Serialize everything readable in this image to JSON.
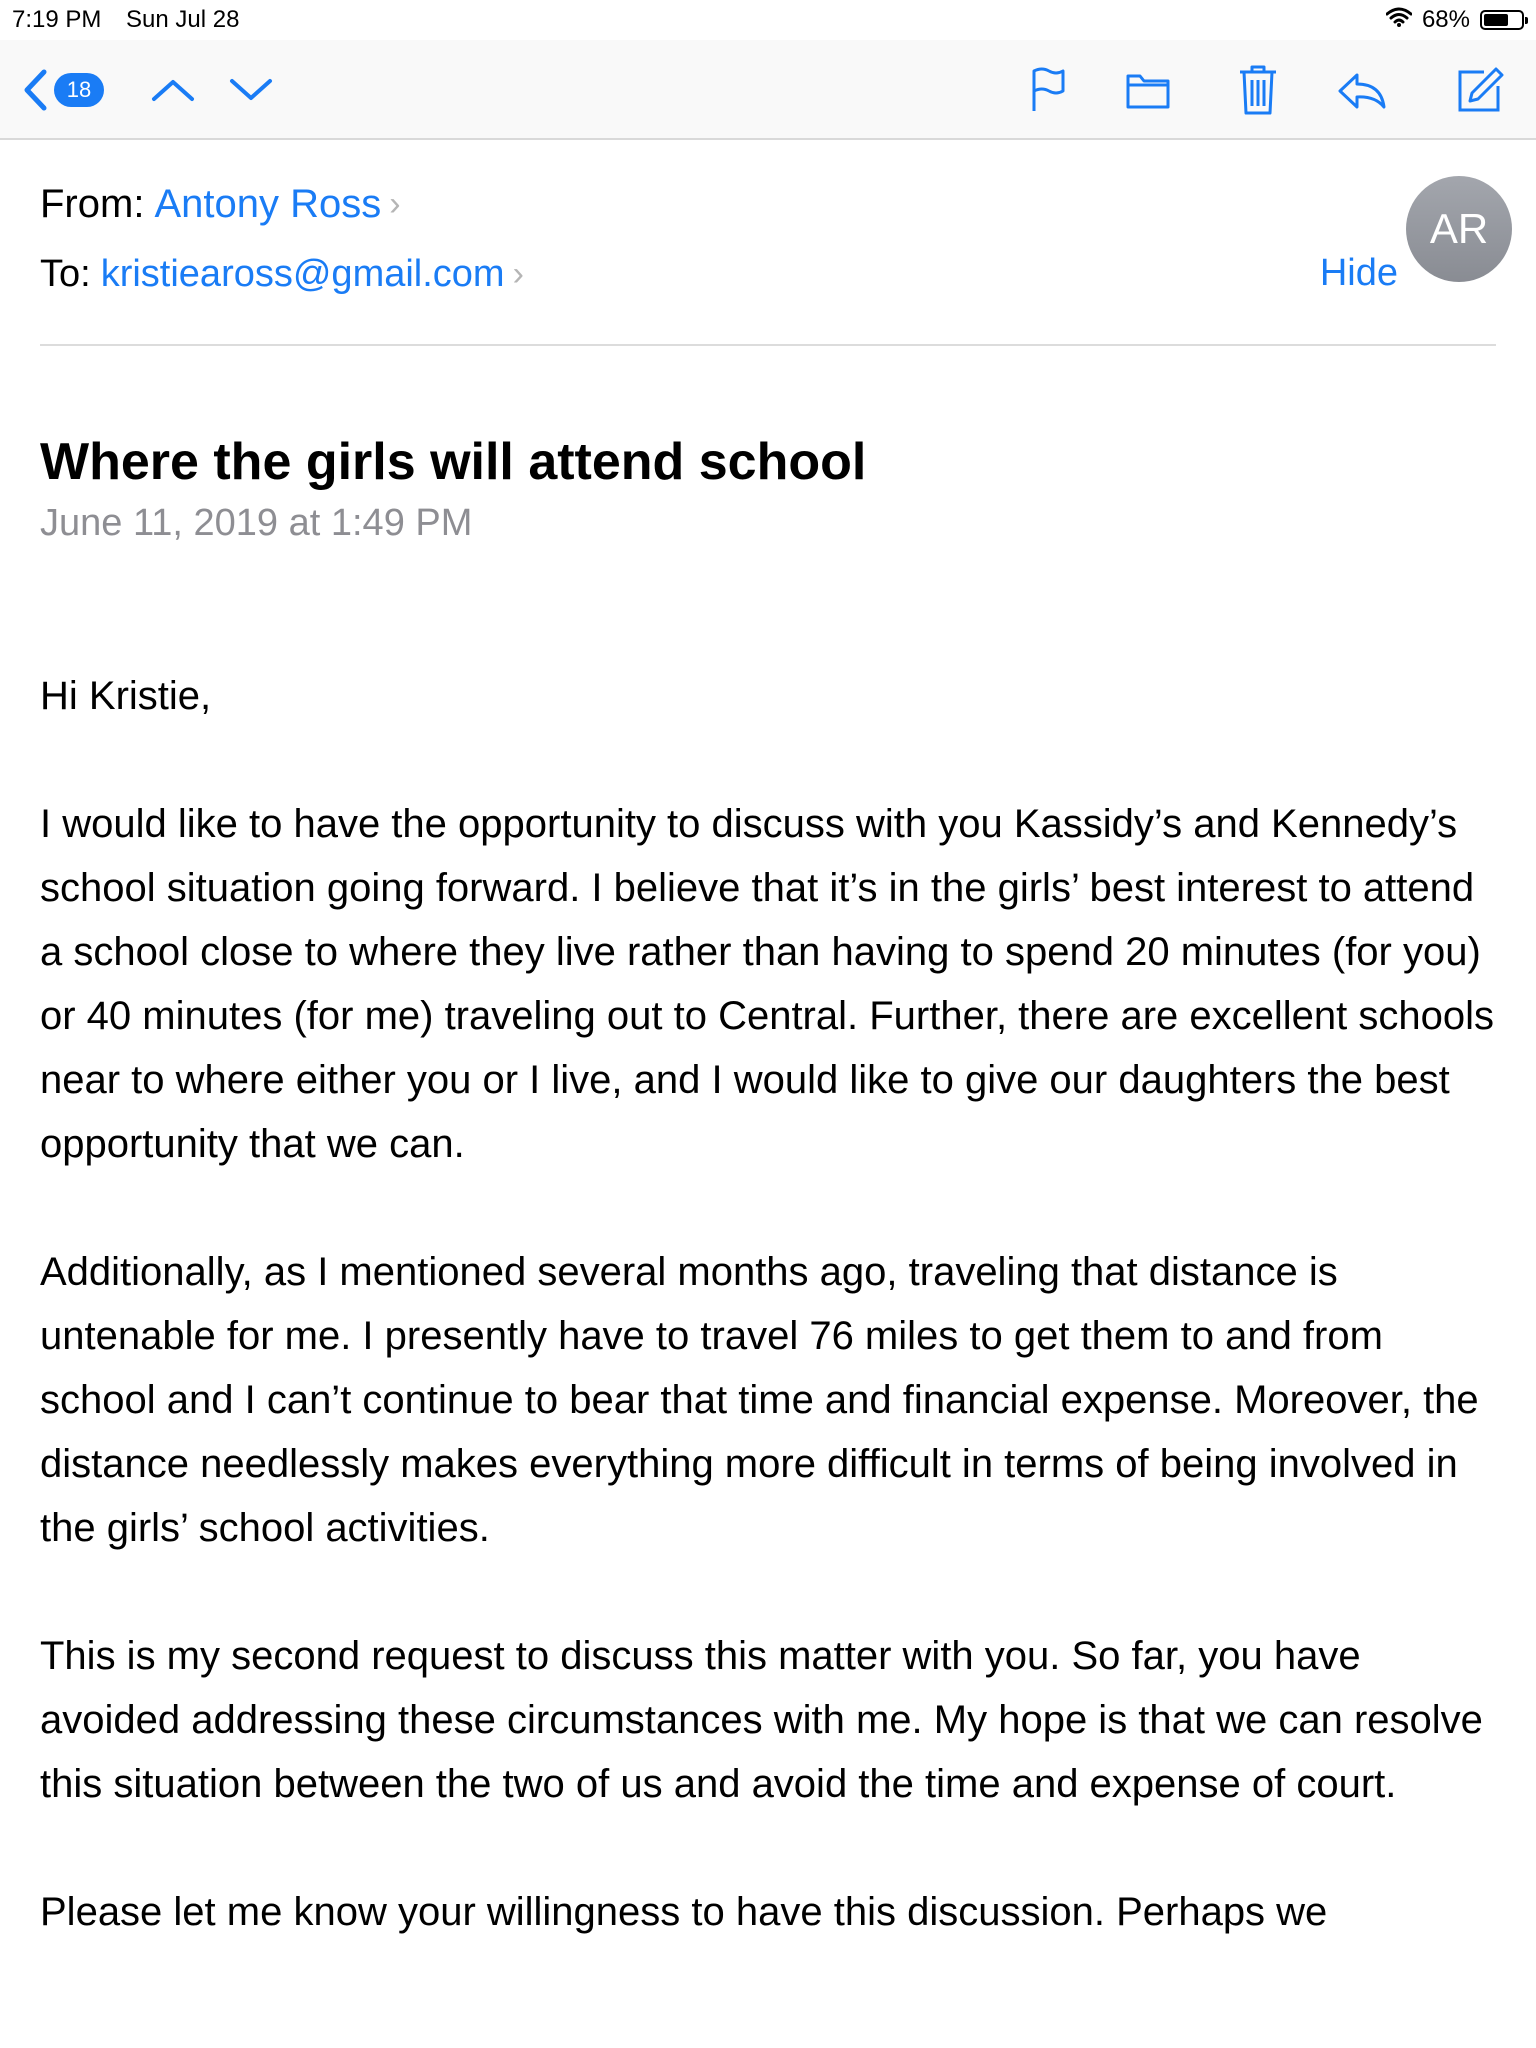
{
  "status_bar": {
    "time": "7:19 PM",
    "date": "Sun Jul 28",
    "battery": "68%",
    "battery_level": 0.68
  },
  "toolbar": {
    "back_count": "18",
    "icons": {
      "back": "chevron-left-icon",
      "prev": "chevron-up-icon",
      "next": "chevron-down-icon",
      "flag": "flag-icon",
      "folder": "folder-icon",
      "trash": "trash-icon",
      "reply": "reply-icon",
      "compose": "compose-icon"
    },
    "accent": "#1a7cf5"
  },
  "header": {
    "from_label": "From:",
    "from_name": "Antony Ross",
    "to_label": "To:",
    "to_address": "kristieaross@gmail.com",
    "hide_label": "Hide",
    "avatar_initials": "AR"
  },
  "message": {
    "subject": "Where the girls will attend school",
    "date": "June 11, 2019 at 1:49 PM",
    "paragraphs": [
      "Hi Kristie,",
      "I would like to have the opportunity to discuss with you Kassidy’s and Kennedy’s school situation going forward. I believe that it’s in the girls’ best interest to attend a school close to where they live rather than having to spend 20 minutes (for you) or 40 minutes (for me) traveling out to Central. Further, there are excellent schools near to where either you or I live, and I would like to give our daughters the best opportunity that we can.",
      "Additionally, as I mentioned several months ago, traveling that distance is untenable for me. I presently have to travel 76 miles to get them to and from school and I can’t continue to bear that time and financial expense. Moreover, the distance needlessly makes everything more difficult in terms of being involved in the girls’ school activities.",
      "This is my second request to discuss this matter with you. So far, you have avoided addressing these circumstances with me. My hope is that we can resolve this situation between the two of us and avoid the time and expense of court.",
      "Please let me know your willingness to have this discussion. Perhaps we"
    ]
  }
}
